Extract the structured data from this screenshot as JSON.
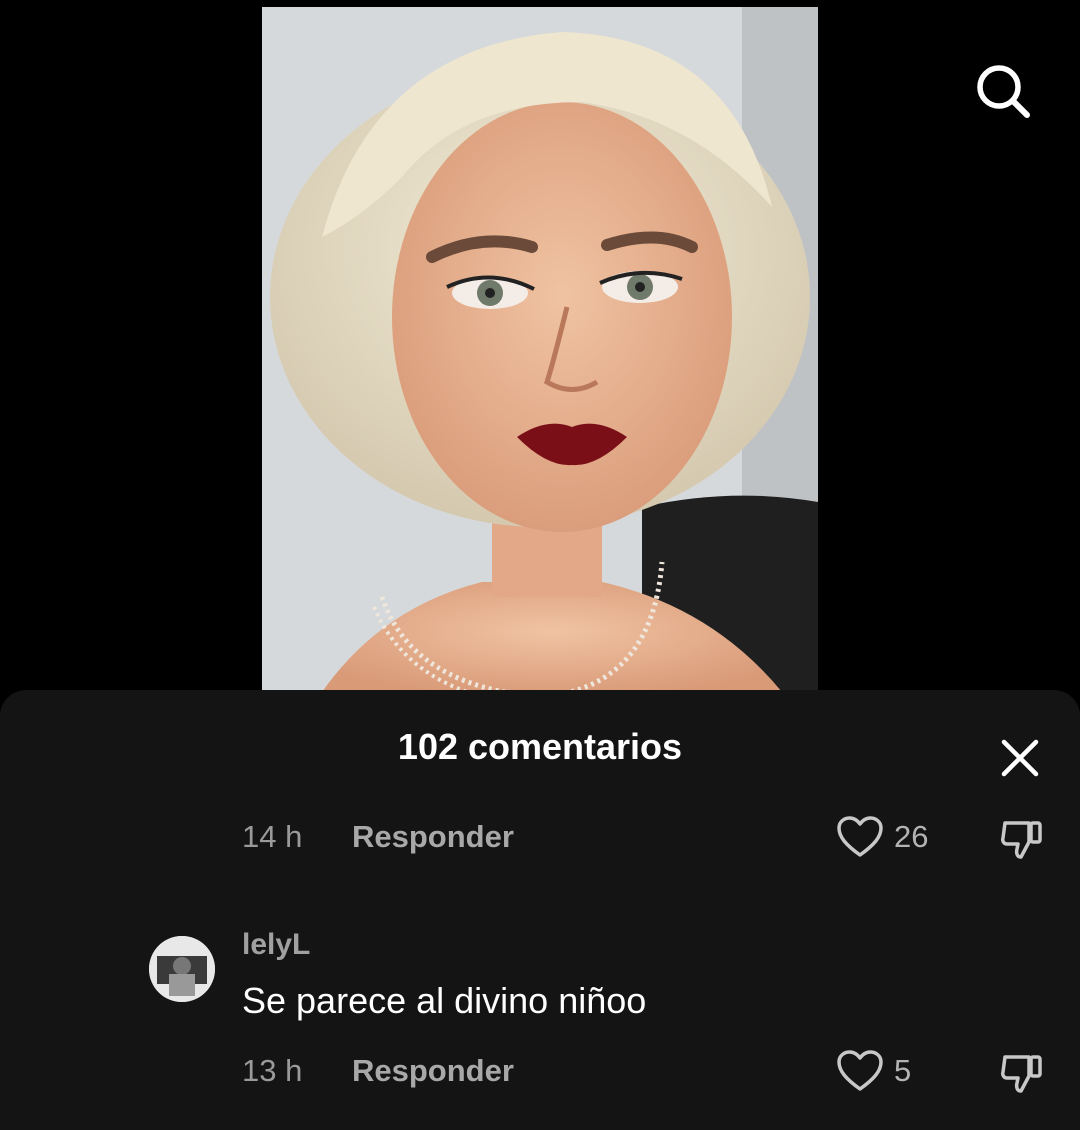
{
  "search": {
    "icon": "search-icon"
  },
  "video": {
    "description_icon": "video-frame"
  },
  "comments": {
    "title": "102 comentarios",
    "close_icon": "close-icon",
    "items": [
      {
        "time": "14 h",
        "reply_label": "Responder",
        "likes": "26"
      },
      {
        "username": "lelyL",
        "text": "Se parece al divino niñoo",
        "time": "13 h",
        "reply_label": "Responder",
        "likes": "5"
      }
    ]
  },
  "colors": {
    "sheet_bg": "#141414",
    "secondary_text": "#9a9a9a",
    "background": "#000000"
  }
}
